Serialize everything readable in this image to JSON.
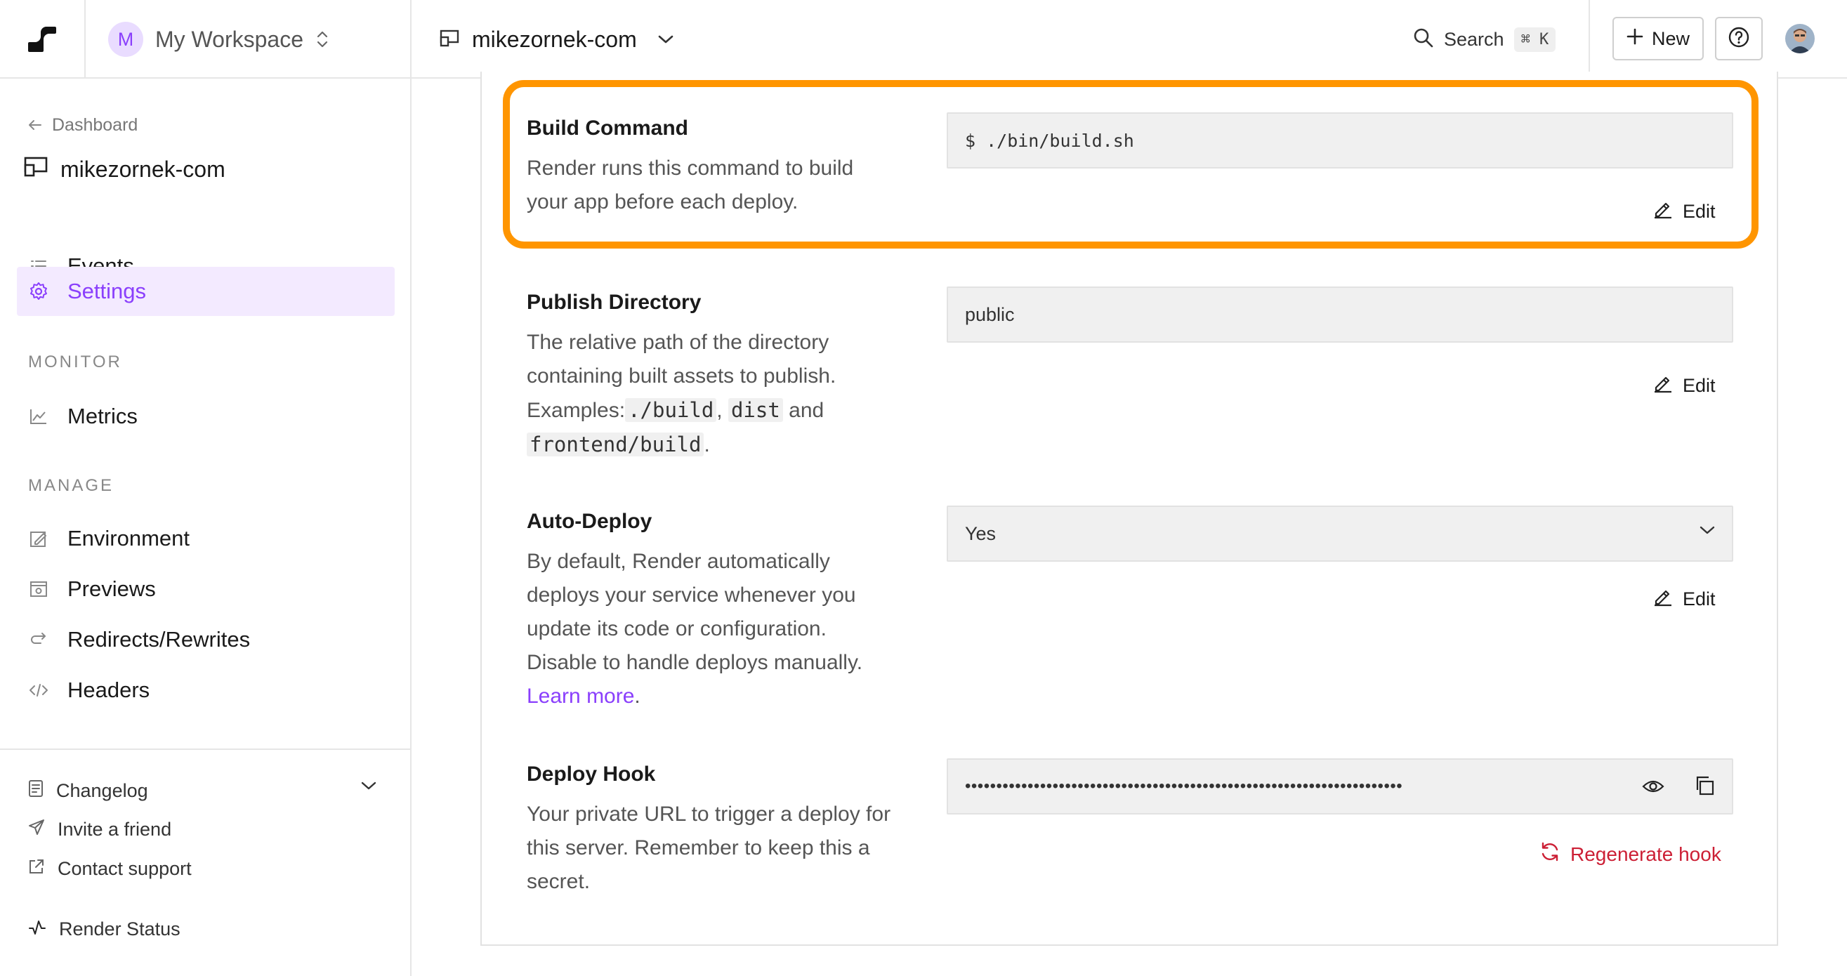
{
  "topbar": {
    "workspace_initial": "M",
    "workspace_name": "My Workspace",
    "service_name": "mikezornek-com",
    "search_label": "Search",
    "search_shortcut": "⌘ K",
    "new_label": "New"
  },
  "sidebar": {
    "back_label": "Dashboard",
    "service_title": "mikezornek-com",
    "items": [
      {
        "label": "Events"
      },
      {
        "label": "Settings"
      }
    ],
    "monitor_label": "MONITOR",
    "monitor_items": [
      {
        "label": "Metrics"
      }
    ],
    "manage_label": "MANAGE",
    "manage_items": [
      {
        "label": "Environment"
      },
      {
        "label": "Previews"
      },
      {
        "label": "Redirects/Rewrites"
      },
      {
        "label": "Headers"
      }
    ],
    "footer": {
      "changelog": "Changelog",
      "invite": "Invite a friend",
      "support": "Contact support",
      "status": "Render Status"
    }
  },
  "settings": {
    "build_command": {
      "title": "Build Command",
      "description": "Render runs this command to build your app before each deploy.",
      "value": "$ ./bin/build.sh",
      "edit_label": "Edit"
    },
    "publish_directory": {
      "title": "Publish Directory",
      "desc_1": "The relative path of the directory containing built assets to publish. Examples:",
      "ex_1": "./build",
      "sep_1": ",",
      "ex_2": "dist",
      "sep_2": "and",
      "ex_3": "frontend/build",
      "end": ".",
      "value": "public",
      "edit_label": "Edit"
    },
    "auto_deploy": {
      "title": "Auto-Deploy",
      "description": "By default, Render automatically deploys your service whenever you update its code or configuration. Disable to handle deploys manually.",
      "link": "Learn more",
      "link_end": ".",
      "value": "Yes",
      "edit_label": "Edit"
    },
    "deploy_hook": {
      "title": "Deploy Hook",
      "description": "Your private URL to trigger a deploy for this server. Remember to keep this a secret.",
      "masked_value": "••••••••••••••••••••••••••••••••••••••••••••••••••••••••••••••••••••••",
      "regenerate_label": "Regenerate hook"
    }
  },
  "colors": {
    "accent": "#8a3ffc",
    "highlight": "#ff9500",
    "danger": "#cc1f35"
  }
}
